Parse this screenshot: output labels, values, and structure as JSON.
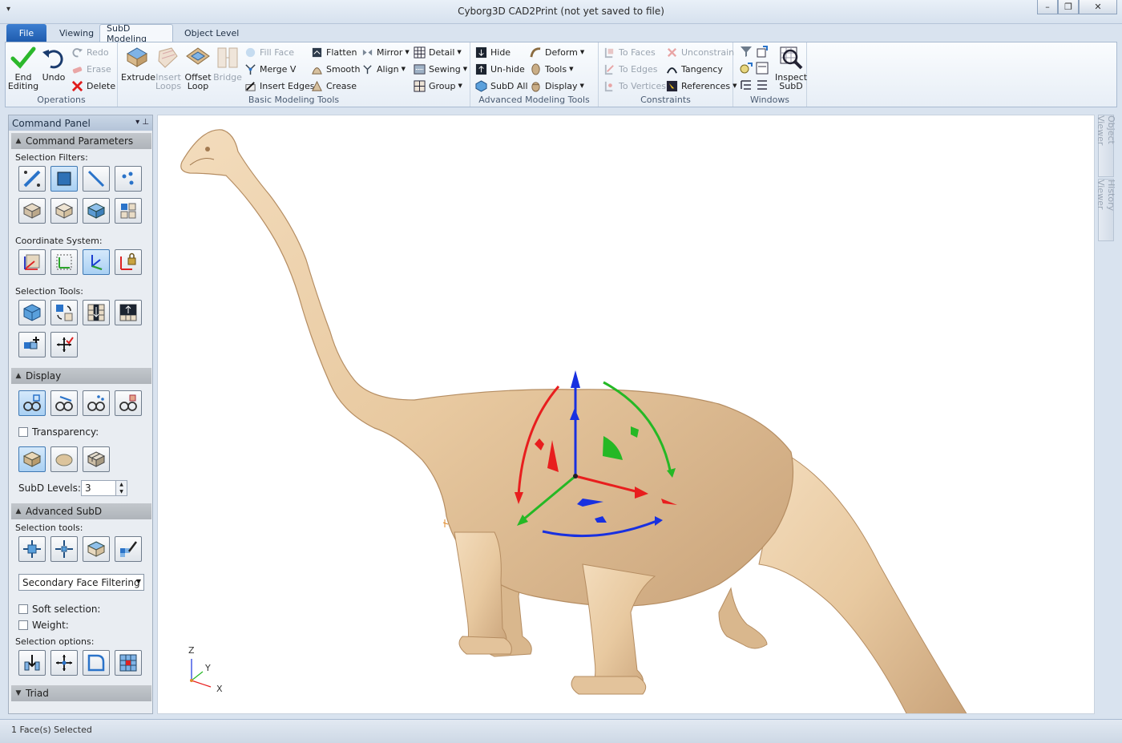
{
  "window": {
    "title": "Cyborg3D CAD2Print  (not yet saved to file)",
    "quick_access": "▾",
    "minimize": "–",
    "maximize": "❐",
    "close": "✕"
  },
  "tabs": [
    "File",
    "Viewing",
    "SubD Modeling",
    "Object Level"
  ],
  "ribbon": {
    "operations": {
      "label": "Operations",
      "end_editing": "End Editing",
      "undo": "Undo",
      "redo": "Redo",
      "erase": "Erase",
      "delete": "Delete"
    },
    "basic": {
      "label": "Basic Modeling Tools",
      "extrude": "Extrude",
      "insert_loops": "Insert Loops",
      "offset_loop": "Offset Loop",
      "bridge": "Bridge",
      "fill_face": "Fill Face",
      "merge_v": "Merge V",
      "insert_edges": "Insert Edges",
      "flatten": "Flatten",
      "smooth": "Smooth",
      "crease": "Crease",
      "mirror": "Mirror",
      "align": "Align",
      "detail": "Detail",
      "sewing": "Sewing",
      "group": "Group"
    },
    "advanced": {
      "label": "Advanced Modeling Tools",
      "hide": "Hide",
      "unhide": "Un-hide",
      "subd_all": "SubD All",
      "deform": "Deform",
      "tools": "Tools",
      "display": "Display"
    },
    "constraints": {
      "label": "Constraints",
      "to_faces": "To Faces",
      "to_edges": "To Edges",
      "to_vertices": "To Vertices",
      "unconstrain": "Unconstrain",
      "tangency": "Tangency",
      "references": "References"
    },
    "windows": {
      "label": "Windows",
      "inspect_subd": "Inspect SubD"
    }
  },
  "panel": {
    "title": "Command Panel",
    "pin": "▾ ⊥",
    "command_parameters": "Command Parameters",
    "selection_filters": "Selection Filters:",
    "coordinate_system": "Coordinate System:",
    "selection_tools": "Selection Tools:",
    "display": "Display",
    "transparency": "Transparency:",
    "subd_levels_label": "SubD Levels:",
    "subd_levels_value": "3",
    "advanced_subd": "Advanced SubD",
    "selection_tools2": "Selection tools:",
    "secondary_filter": "Secondary Face Filtering",
    "soft_selection": "Soft selection:",
    "weight": "Weight:",
    "selection_options": "Selection options:",
    "triad": "Triad"
  },
  "viewport": {
    "axis_z": "Z",
    "axis_y": "Y",
    "axis_x": "X",
    "side_tabs": [
      "Object Viewer",
      "History Viewer"
    ]
  },
  "status": {
    "text": "1 Face(s) Selected"
  },
  "colors": {
    "model_fill": "#e8c9a0",
    "model_shade": "#b98f63",
    "gizmo_red": "#e81e1e",
    "gizmo_green": "#25b825",
    "gizmo_blue": "#1830e0",
    "accent_blue": "#1f5cae"
  }
}
